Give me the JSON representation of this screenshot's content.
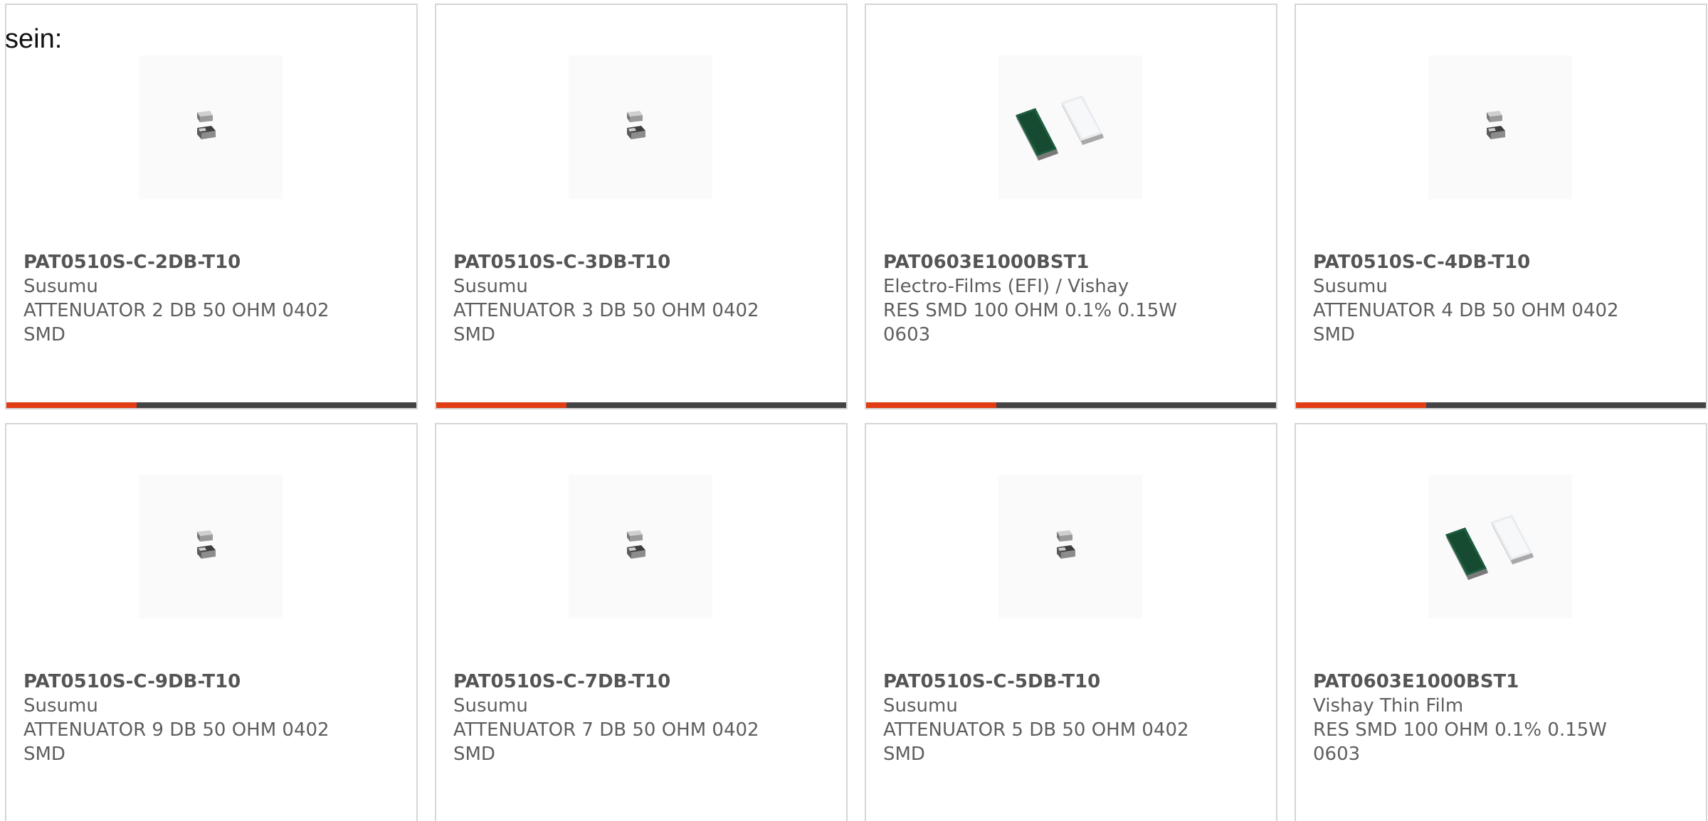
{
  "lead_text": "sein:",
  "colors": {
    "accent": "#e13c14",
    "bar": "#444444",
    "card_border": "#d6d6d6"
  },
  "products": [
    {
      "part_number": "PAT0510S-C-2DB-T10",
      "manufacturer": "Susumu",
      "description": "ATTENUATOR 2 DB 50 OHM 0402 SMD",
      "image_icon": "attenuator-chip-image"
    },
    {
      "part_number": "PAT0510S-C-3DB-T10",
      "manufacturer": "Susumu",
      "description": "ATTENUATOR 3 DB 50 OHM 0402 SMD",
      "image_icon": "attenuator-chip-image"
    },
    {
      "part_number": "PAT0603E1000BST1",
      "manufacturer": "Electro-Films (EFI) / Vishay",
      "description": "RES SMD 100 OHM 0.1% 0.15W 0603",
      "image_icon": "thin-film-resistor-image"
    },
    {
      "part_number": "PAT0510S-C-4DB-T10",
      "manufacturer": "Susumu",
      "description": "ATTENUATOR 4 DB 50 OHM 0402 SMD",
      "image_icon": "attenuator-chip-image"
    },
    {
      "part_number": "PAT0510S-C-9DB-T10",
      "manufacturer": "Susumu",
      "description": "ATTENUATOR 9 DB 50 OHM 0402 SMD",
      "image_icon": "attenuator-chip-image"
    },
    {
      "part_number": "PAT0510S-C-7DB-T10",
      "manufacturer": "Susumu",
      "description": "ATTENUATOR 7 DB 50 OHM 0402 SMD",
      "image_icon": "attenuator-chip-image"
    },
    {
      "part_number": "PAT0510S-C-5DB-T10",
      "manufacturer": "Susumu",
      "description": "ATTENUATOR 5 DB 50 OHM 0402 SMD",
      "image_icon": "attenuator-chip-image"
    },
    {
      "part_number": "PAT0603E1000BST1",
      "manufacturer": "Vishay Thin Film",
      "description": "RES SMD 100 OHM 0.1% 0.15W 0603",
      "image_icon": "thin-film-resistor-image"
    }
  ]
}
